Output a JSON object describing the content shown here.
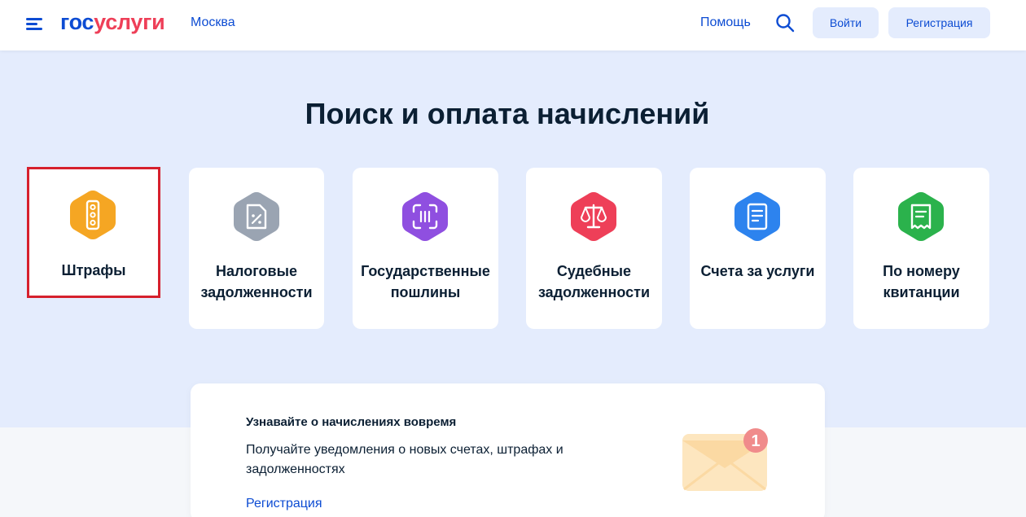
{
  "header": {
    "logo_part1": "гос",
    "logo_part2": "услуги",
    "city": "Москва",
    "help": "Помощь",
    "login_button": "Войти",
    "register_button": "Регистрация"
  },
  "page": {
    "title": "Поиск и оплата начислений"
  },
  "categories": [
    {
      "label": "Штрафы",
      "icon": "traffic-light-icon",
      "color": "#f5a623",
      "selected": true
    },
    {
      "label": "Налоговые задолженности",
      "icon": "tax-document-icon",
      "color": "#9aa4b2"
    },
    {
      "label": "Государственные пошлины",
      "icon": "scan-code-icon",
      "color": "#8f4fe0"
    },
    {
      "label": "Судебные задолженности",
      "icon": "scales-icon",
      "color": "#ee3f58"
    },
    {
      "label": "Счета за услуги",
      "icon": "invoice-icon",
      "color": "#2d83ee"
    },
    {
      "label": "По номеру квитанции",
      "icon": "receipt-icon",
      "color": "#2bb24c"
    }
  ],
  "notification": {
    "title": "Узнавайте о начислениях вовремя",
    "text": "Получайте уведомления о новых счетах, штрафах и задолженностях",
    "link": "Регистрация",
    "badge_count": "1"
  },
  "colors": {
    "brand_blue": "#0d4cd3",
    "brand_red": "#ee3f58",
    "hero_bg": "#e4ecfd",
    "highlight_outline": "#d6202d"
  }
}
